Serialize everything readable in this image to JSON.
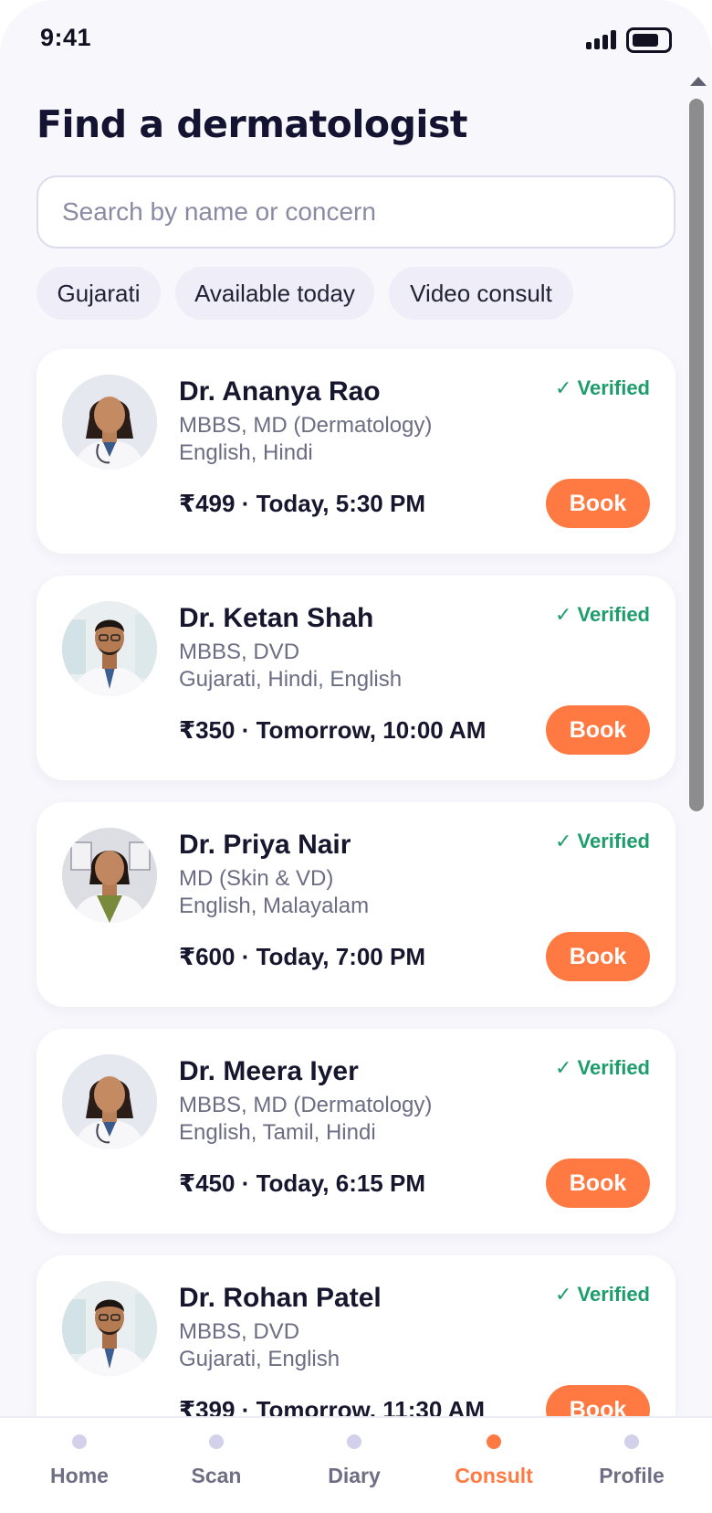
{
  "status_bar": {
    "time": "9:41"
  },
  "page": {
    "title": "Find a dermatologist",
    "search": {
      "placeholder": "Search by name or concern",
      "value": ""
    },
    "filters": [
      "Gujarati",
      "Available today",
      "Video consult"
    ]
  },
  "doctors": [
    {
      "name": "Dr. Ananya Rao",
      "qualification": "MBBS, MD (Dermatology)",
      "languages": "English, Hindi",
      "fee_slot": "₹499 · Today, 5:30 PM",
      "verified": "✓ Verified",
      "action": "Book",
      "avatar": "female-doctor-portrait"
    },
    {
      "name": "Dr. Ketan Shah",
      "qualification": "MBBS, DVD",
      "languages": "Gujarati, Hindi, English",
      "fee_slot": "₹350 · Tomorrow, 10:00 AM",
      "verified": "✓ Verified",
      "action": "Book",
      "avatar": "male-doctor-portrait"
    },
    {
      "name": "Dr. Priya Nair",
      "qualification": "MD (Skin & VD)",
      "languages": "English, Malayalam",
      "fee_slot": "₹600 · Today, 7:00 PM",
      "verified": "✓ Verified",
      "action": "Book",
      "avatar": "female-doctor-portrait"
    },
    {
      "name": "Dr. Meera Iyer",
      "qualification": "MBBS, MD (Dermatology)",
      "languages": "English, Tamil, Hindi",
      "fee_slot": "₹450 · Today, 6:15 PM",
      "verified": "✓ Verified",
      "action": "Book",
      "avatar": "female-doctor-portrait"
    },
    {
      "name": "Dr. Rohan Patel",
      "qualification": "MBBS, DVD",
      "languages": "Gujarati, English",
      "fee_slot": "₹399 · Tomorrow, 11:30 AM",
      "verified": "✓ Verified",
      "action": "Book",
      "avatar": "male-doctor-portrait"
    }
  ],
  "tab_bar": {
    "items": [
      "Home",
      "Scan",
      "Diary",
      "Consult",
      "Profile"
    ],
    "active": "Consult"
  },
  "colors": {
    "accent": "#ff7a42",
    "verified": "#1e9d6c",
    "title": "#141432",
    "background": "#f7f7fc"
  }
}
